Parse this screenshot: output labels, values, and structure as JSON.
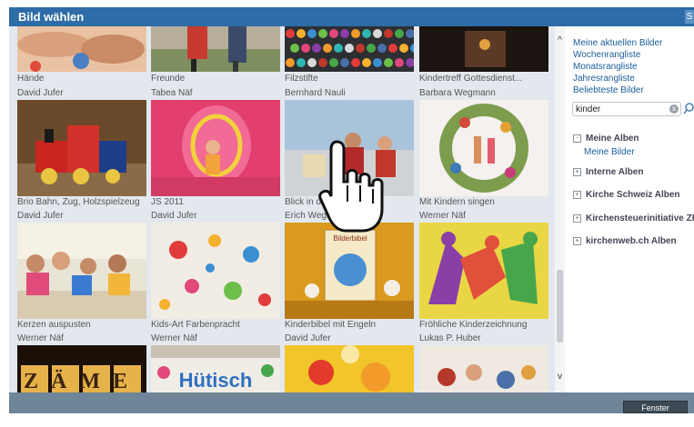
{
  "dialog": {
    "title": "Bild wählen",
    "close_glyph": "S"
  },
  "gallery": {
    "row0": [
      {
        "caption": "Hände"
      },
      {
        "caption": "Freunde"
      },
      {
        "caption": "Filzstifte"
      },
      {
        "caption": "Kindertreff Gottesdienst..."
      }
    ],
    "row1": [
      {
        "author": "David Jufer",
        "caption": "Brio Bahn, Zug, Holzspielzeug"
      },
      {
        "author": "Tabea Näf",
        "caption": "JS 2011"
      },
      {
        "author": "Bernhard Nauli",
        "caption": "Blick in die Pi"
      },
      {
        "author": "Barbara Wegmann",
        "caption": "Mit Kindern singen"
      }
    ],
    "row2": [
      {
        "author": "David Jufer",
        "caption": "Kerzen auspusten"
      },
      {
        "author": "David Jufer",
        "caption": "Kids-Art Farbenpracht"
      },
      {
        "author": "Erich Wegmar",
        "caption": "Kinderbibel mit Engeln",
        "book_title": "Bilderbibel"
      },
      {
        "author": "Werner Näf",
        "caption": "Fröhliche Kinderzeichnung"
      }
    ],
    "row3": [
      {
        "author": "Werner Näf",
        "letters": "ZÄME"
      },
      {
        "author": "Werner Näf",
        "letters": "Hütisch"
      },
      {
        "author": "David Jufer"
      },
      {
        "author": "Lukas P. Huber"
      }
    ]
  },
  "scrollbar": {
    "up_glyph": "^",
    "down_glyph": "v"
  },
  "sidebar": {
    "links": [
      "Meine aktuellen Bilder",
      "Wochenrangliste",
      "Monatsrangliste",
      "Jahresrangliste",
      "Beliebteste Bilder"
    ],
    "search": {
      "value": "kinder",
      "clear_glyph": "x"
    },
    "albums": [
      {
        "toggle": "-",
        "label": "Meine Alben"
      },
      {
        "toggle": "+",
        "label": "Interne Alben"
      },
      {
        "toggle": "+",
        "label": "Kirche Schweiz Alben"
      },
      {
        "toggle": "+",
        "label": "Kirchensteuerinitiative ZH"
      },
      {
        "toggle": "+",
        "label": "kirchenweb.ch Alben"
      }
    ],
    "sub_album": "Meine Bilder"
  },
  "footer": {
    "close_button": "Fenster schliessen"
  },
  "colors": {
    "title_bar": "#2d6ca6",
    "link": "#1a5c9a",
    "footer": "#6f8598",
    "gallery_bg": "#e2e8ee"
  }
}
